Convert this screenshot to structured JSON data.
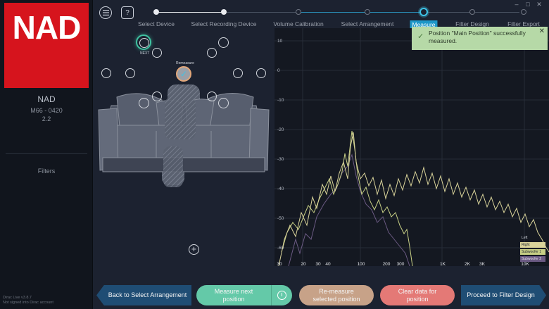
{
  "app": {
    "logo_text": "NAD",
    "device_name": "NAD",
    "device_model": "M66 - 0420",
    "device_version": "2.2",
    "sidebar_filters": "Filters",
    "footer_line1": "Dirac Live v3.8.7",
    "footer_line2": "Not signed into Dirac account"
  },
  "window_controls": {
    "minimize": "–",
    "maximize": "□",
    "close": "✕"
  },
  "toolbar": {
    "menu_icon": "hamburger-menu-icon",
    "help_label": "?"
  },
  "steps": [
    {
      "label": "Select Device",
      "state": "done"
    },
    {
      "label": "Select Recording Device",
      "state": "done"
    },
    {
      "label": "Volume Calibration",
      "state": "pending"
    },
    {
      "label": "Select Arrangement",
      "state": "pending"
    },
    {
      "label": "Measure",
      "state": "active"
    },
    {
      "label": "Filter Design",
      "state": "pending"
    },
    {
      "label": "Filter Export",
      "state": "pending"
    }
  ],
  "room": {
    "next_label": "NEXT",
    "remeasure_label": "Remeasure",
    "add_label": "+"
  },
  "toast": {
    "message_line1": "Position \"Main Position\" successfully",
    "message_line2": "measured.",
    "close_label": "✕"
  },
  "graph": {
    "y_ticks": [
      "10",
      "0",
      "-10",
      "-20",
      "-30",
      "-40",
      "-50",
      "-60"
    ],
    "x_ticks": [
      "30",
      "20",
      "30",
      "40",
      "100",
      "200",
      "300",
      "1K",
      "2K",
      "3K",
      "10K"
    ],
    "legend_title": "Left",
    "legend": [
      {
        "label": "Right",
        "color": "#d9d39a"
      },
      {
        "label": "Subwoofer 1",
        "color": "#c7cf85"
      },
      {
        "label": "Subwoofer 2",
        "color": "#6b5a83"
      }
    ]
  },
  "buttons": {
    "back": "Back to Select Arrangement",
    "measure_next_line1": "Measure next",
    "measure_next_line2": "position",
    "remeasure_line1": "Re-measure",
    "remeasure_line2": "selected position",
    "clear_line1": "Clear data for",
    "clear_line2": "position",
    "proceed": "Proceed to Filter Design"
  }
}
